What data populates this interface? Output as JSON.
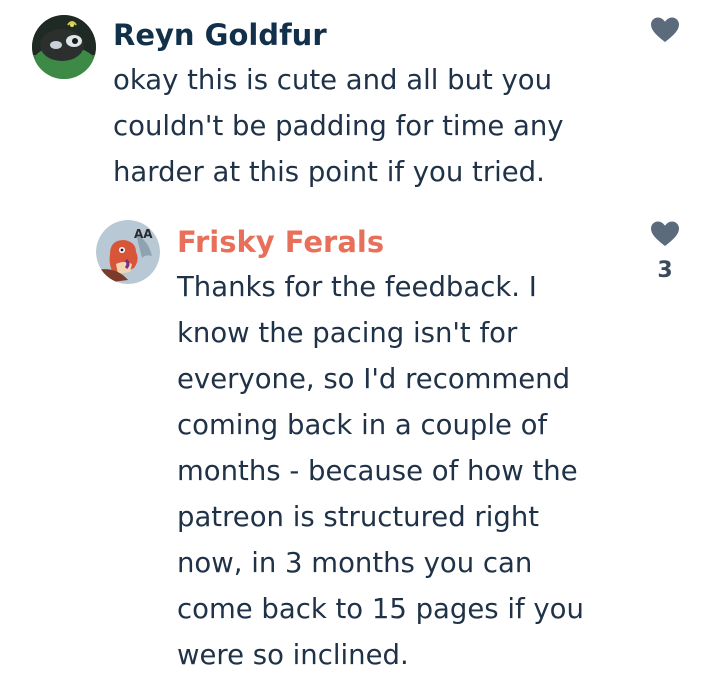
{
  "comments": [
    {
      "author": "Reyn Goldfur",
      "lines": [
        "okay this is cute and all but you",
        "couldn't be padding for time any",
        "harder at this point if you tried."
      ],
      "like_count": null,
      "avatar_icon": "dark-creature-avatar",
      "author_color": "#12304a"
    },
    {
      "author": "Frisky Ferals",
      "lines": [
        "Thanks for the feedback. I",
        "know the pacing isn't for",
        "everyone, so I'd recommend",
        "coming back in a couple of",
        "months - because of how the",
        "patreon is structured right",
        "now, in 3 months you can",
        "come back to 15 pages if you",
        "were so inclined."
      ],
      "like_count": "3",
      "avatar_icon": "red-dragon-avatar",
      "author_color": "#e8705a"
    }
  ],
  "icons": {
    "like": "heart-icon",
    "heart_color": "#5b6b7b"
  }
}
